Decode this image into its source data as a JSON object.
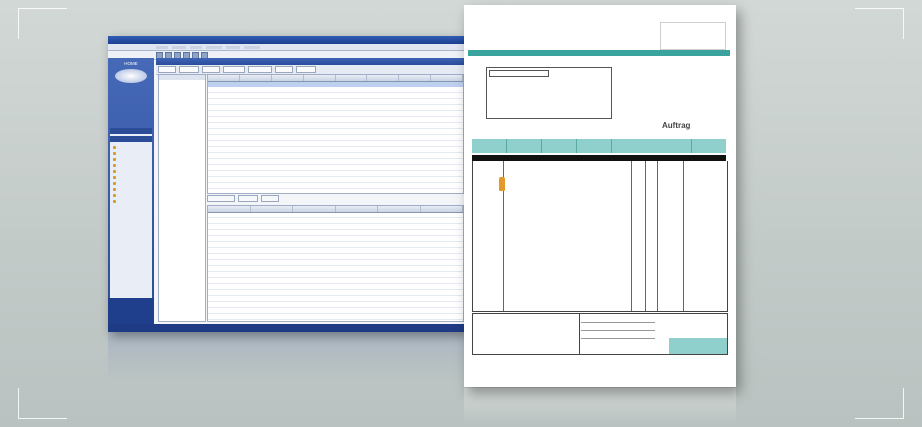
{
  "software": {
    "doc_title": "Auftrag",
    "brand_top": "HOME"
  },
  "colors": {
    "window_blue": "#2c4c98",
    "teal": "#3aa39e",
    "teal_light": "#8fd0cc",
    "accent_orange": "#e39a2a"
  },
  "icons": [
    "window-logo-icon",
    "sidebar-item-icon",
    "toolbar-button-icon",
    "product-bottle-icon"
  ]
}
